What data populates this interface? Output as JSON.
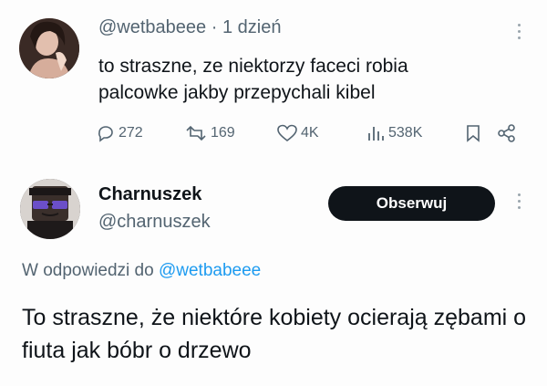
{
  "quoted_tweet": {
    "handle": "@wetbabeee",
    "separator": "·",
    "time": "1 dzień",
    "text": "to straszne, ze niektorzy faceci robia palcowke jakby przepychali kibel",
    "stats": {
      "replies": "272",
      "retweets": "169",
      "likes": "4K",
      "views": "538K"
    },
    "icons": [
      "reply-icon",
      "retweet-icon",
      "like-icon",
      "views-icon",
      "bookmark-icon",
      "share-icon",
      "more-icon"
    ]
  },
  "reply_tweet": {
    "name": "Charnuszek",
    "handle": "@charnuszek",
    "follow_label": "Obserwuj",
    "reply_prefix": "W odpowiedzi do",
    "reply_mention": "@wetbabeee",
    "text": "To straszne, że niektóre kobiety ocierają zębami o fiuta jak bóbr o drzewo"
  },
  "colors": {
    "text": "#0f1419",
    "secondary": "#536471",
    "link": "#1d9bf0",
    "button_bg": "#0f1419",
    "button_text": "#ffffff"
  }
}
